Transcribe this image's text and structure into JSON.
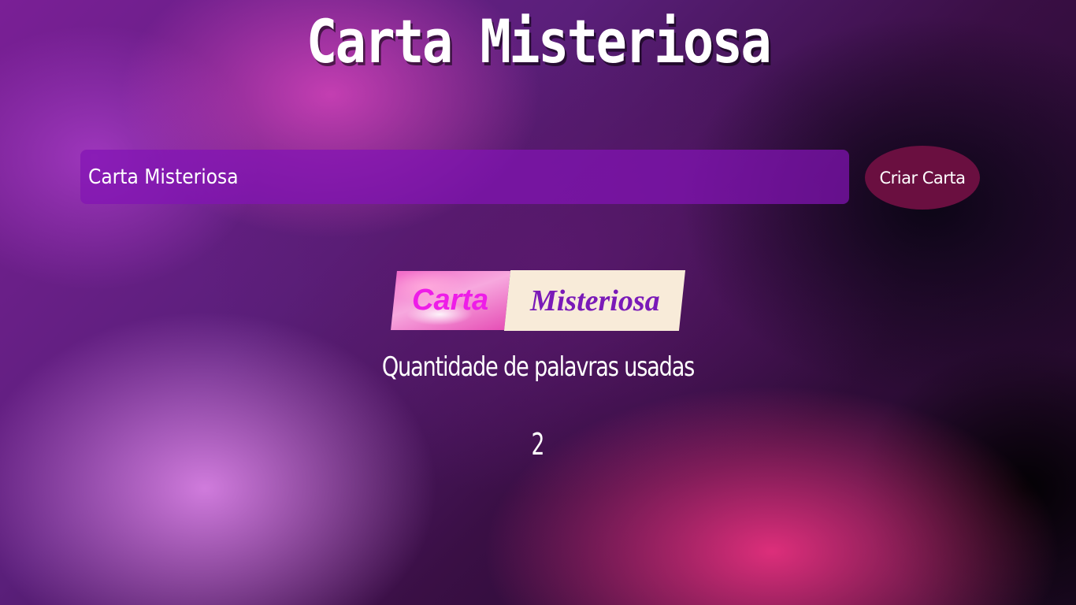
{
  "header": {
    "title": "Carta Misteriosa"
  },
  "form": {
    "input_value": "Carta Misteriosa",
    "create_button_label": "Criar Carta"
  },
  "card": {
    "words": [
      "Carta",
      "Misteriosa"
    ]
  },
  "counter": {
    "label": "Quantidade de palavras usadas",
    "value": "2"
  },
  "colors": {
    "button_bg": "#6a0f40",
    "input_bg": "#8214b4",
    "word_1_text": "#ee1ce8",
    "word_2_text": "#7a1ab8",
    "word_2_bg": "#f8ebd9"
  }
}
